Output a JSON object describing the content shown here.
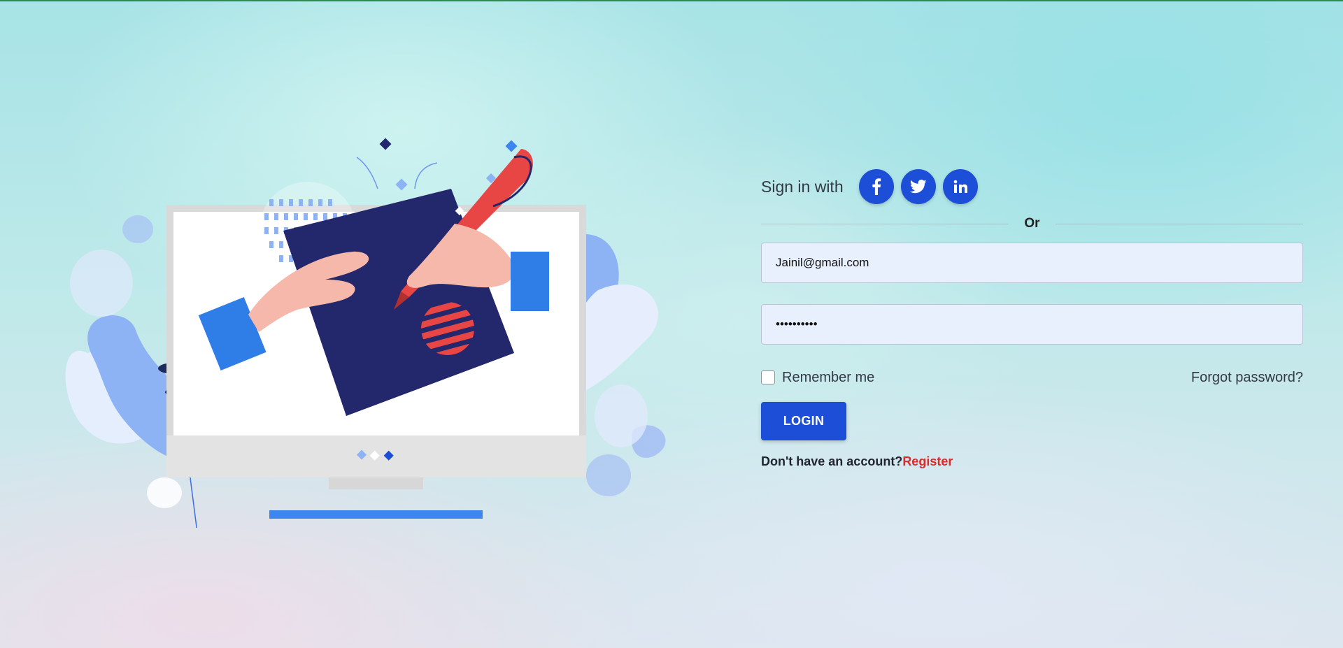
{
  "illustration": {
    "description_icon": "desktop-drawing-illustration"
  },
  "signin": {
    "label": "Sign in with",
    "socials": [
      {
        "name": "facebook",
        "icon": "facebook-icon"
      },
      {
        "name": "twitter",
        "icon": "twitter-icon"
      },
      {
        "name": "linkedin",
        "icon": "linkedin-icon"
      }
    ]
  },
  "divider": {
    "text": "Or"
  },
  "form": {
    "email_value": "Jainil@gmail.com",
    "password_value": "••••••••••"
  },
  "options": {
    "remember_label": "Remember me",
    "remember_checked": false,
    "forgot_label": "Forgot password?"
  },
  "login": {
    "label": "LOGIN"
  },
  "register": {
    "prompt": "Don't have an account?",
    "link_label": "Register"
  },
  "colors": {
    "primary": "#1d4ed8",
    "register_link": "#d92b2b",
    "input_bg": "#e8f0fe"
  }
}
